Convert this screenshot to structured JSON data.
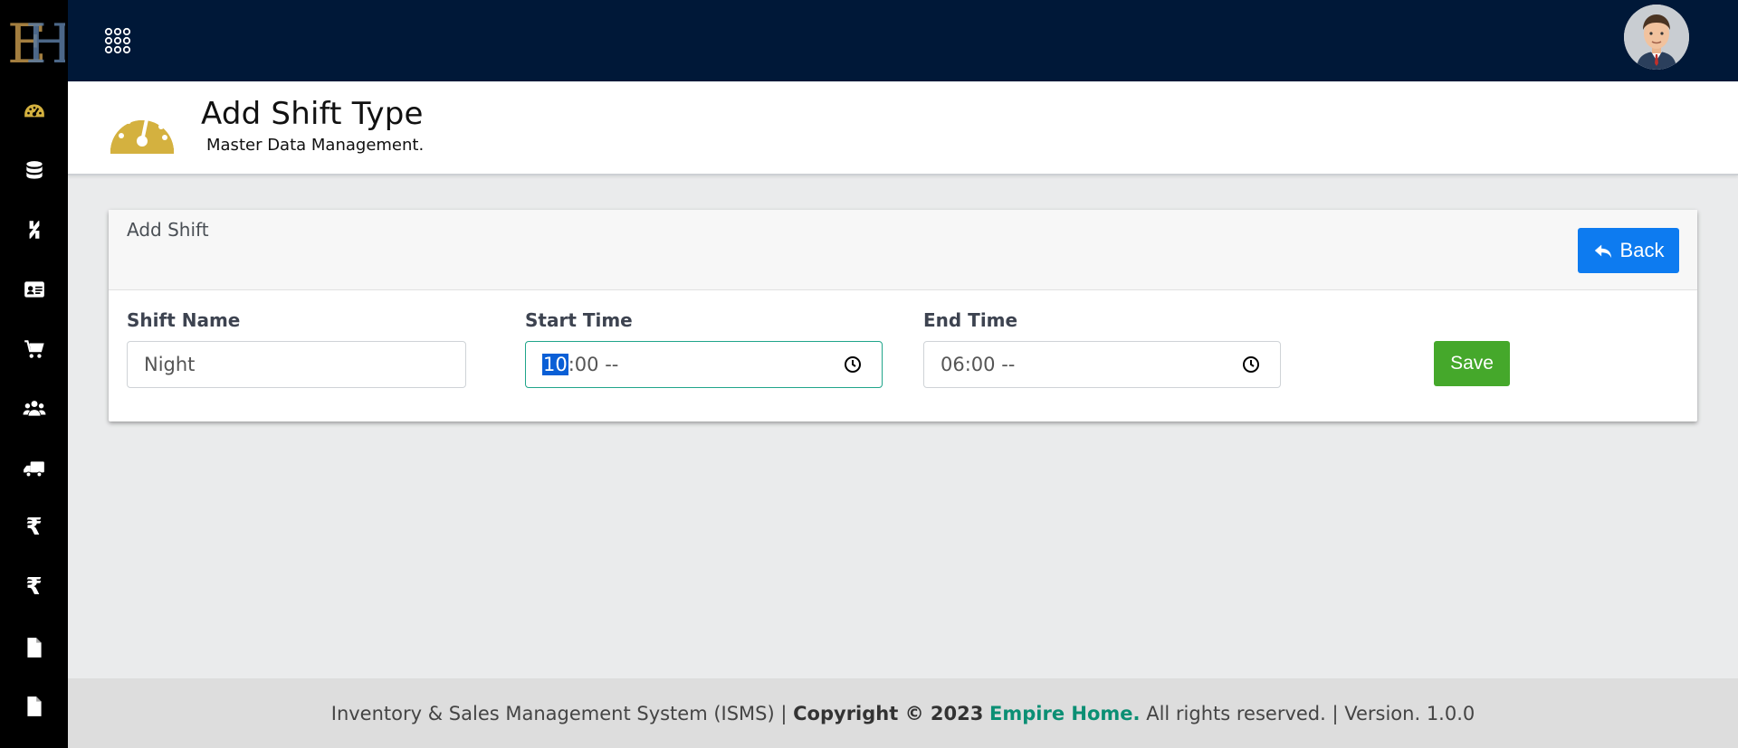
{
  "app": {
    "logo_text": "EH",
    "avatar_alt": "user"
  },
  "sidebar": {
    "items": [
      {
        "icon": "dashboard-icon"
      },
      {
        "icon": "database-icon"
      },
      {
        "icon": "product-hunt-icon"
      },
      {
        "icon": "id-card-icon"
      },
      {
        "icon": "cart-icon"
      },
      {
        "icon": "users-icon"
      },
      {
        "icon": "truck-icon"
      },
      {
        "icon": "rupee-icon",
        "glyph": "₹"
      },
      {
        "icon": "rupee-icon",
        "glyph": "₹"
      },
      {
        "icon": "file-icon"
      },
      {
        "icon": "file-icon"
      }
    ]
  },
  "header": {
    "title": "Add Shift Type",
    "subtitle": "Master Data Management."
  },
  "card": {
    "title": "Add Shift",
    "back_label": "Back",
    "save_label": "Save",
    "fields": {
      "shift_name": {
        "label": "Shift Name",
        "value": "Night"
      },
      "start_time": {
        "label": "Start Time",
        "hour": "10",
        "rest": ":00 --"
      },
      "end_time": {
        "label": "End Time",
        "value": "06:00 --"
      }
    }
  },
  "footer": {
    "prefix": "Inventory & Sales Management System (ISMS) | ",
    "copyright": "Copyright © 2023",
    "brand": "Empire Home.",
    "suffix": " All rights reserved. | Version. 1.0.0"
  },
  "colors": {
    "topbar": "#001838",
    "sidebar": "#000000",
    "accent_gold": "#d4b13f",
    "back_button": "#0d7bf0",
    "save_button": "#45a82b",
    "brand_link": "#0b8f74"
  }
}
